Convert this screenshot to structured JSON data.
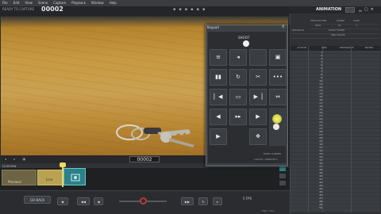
{
  "menu": [
    "File",
    "Edit",
    "View",
    "Scene",
    "Capture",
    "Playback",
    "Window",
    "Help"
  ],
  "status": {
    "label": "READY TO CAPTURE",
    "counter": "00002"
  },
  "viewport": {
    "frame_counter": "00002"
  },
  "timeline": {
    "track_label": "Liveview",
    "frames": [
      {
        "label": "Previous"
      },
      {
        "label": "Live"
      }
    ]
  },
  "transport": {
    "back_label": "GO BACK",
    "fps": "5 FPS"
  },
  "bottom_status": "Mem: 00%",
  "right_panel": {
    "title": "ANIMATION",
    "info_labels": [
      "PRODUCTION",
      "SCENE",
      "TAKE",
      "ANIMATOR",
      "START FRAME",
      "END FRAME"
    ],
    "info_values": [
      "0001",
      "01",
      "1"
    ],
    "xsheet_headers": [
      "ACTION",
      "FRM",
      "KEYFRAMES",
      "NOTES"
    ],
    "frame_numbers": [
      "1",
      "2",
      "3",
      "4",
      "5",
      "6",
      "7",
      "8",
      "9",
      "10",
      "11",
      "12",
      "13",
      "14",
      "15",
      "16",
      "17",
      "18",
      "19",
      "20",
      "21",
      "22",
      "23",
      "24",
      "25",
      "26",
      "27",
      "28",
      "29",
      "30",
      "31",
      "32",
      "33",
      "34",
      "35",
      "36",
      "37",
      "38",
      "39",
      "40",
      "41",
      "42",
      "43",
      "44",
      "45",
      "46",
      "47",
      "48",
      "49",
      "50"
    ]
  },
  "keypad": {
    "title": "Keypad",
    "close": "X",
    "section_label": "SHOOT",
    "footer_1": "PRINT SCREEN",
    "footer_2": "LAYOUT / REMOTE ▾",
    "buttons": [
      {
        "icon": "grid-icon",
        "glyph": "≡"
      },
      {
        "icon": "speaker-icon",
        "glyph": "◂"
      },
      {
        "icon": "blank",
        "glyph": ""
      },
      {
        "icon": "frame-icon",
        "glyph": "▣"
      },
      {
        "icon": "onion-icon",
        "glyph": "▮▮"
      },
      {
        "icon": "loop-icon",
        "glyph": "↻"
      },
      {
        "icon": "cut-icon",
        "glyph": "✂"
      },
      {
        "icon": "dots-icon",
        "glyph": "•••"
      },
      {
        "icon": "first-frame-icon",
        "glyph": "▏◀"
      },
      {
        "icon": "toggle-icon",
        "glyph": "▭"
      },
      {
        "icon": "last-frame-icon",
        "glyph": "▶▕"
      },
      {
        "icon": "arrows-icon",
        "glyph": "⇔"
      },
      {
        "icon": "prev-icon",
        "glyph": "◀"
      },
      {
        "icon": "step-icon",
        "glyph": "▸▸"
      },
      {
        "icon": "next-icon",
        "glyph": "▶"
      },
      {
        "icon": "play-icon",
        "glyph": "▶"
      },
      {
        "icon": "move-icon",
        "glyph": "✥"
      }
    ]
  },
  "colors": {
    "accent": "#58d0d8",
    "playhead": "#e9d36c",
    "record": "#b83a3a"
  }
}
